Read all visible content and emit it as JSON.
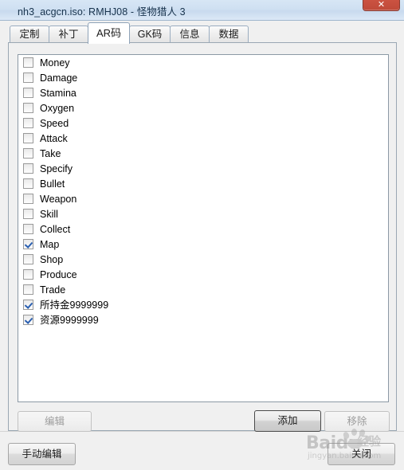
{
  "window": {
    "title": "nh3_acgcn.iso: RMHJ08 - 怪物猎人 3",
    "close_glyph": "✕"
  },
  "tabs": [
    {
      "label": "定制",
      "active": false
    },
    {
      "label": "补丁",
      "active": false
    },
    {
      "label": "AR码",
      "active": true
    },
    {
      "label": "GK码",
      "active": false
    },
    {
      "label": "信息",
      "active": false
    },
    {
      "label": "数据",
      "active": false
    }
  ],
  "cheat_list": [
    {
      "label": "Money",
      "checked": false
    },
    {
      "label": "Damage",
      "checked": false
    },
    {
      "label": "Stamina",
      "checked": false
    },
    {
      "label": "Oxygen",
      "checked": false
    },
    {
      "label": "Speed",
      "checked": false
    },
    {
      "label": "Attack",
      "checked": false
    },
    {
      "label": "Take",
      "checked": false
    },
    {
      "label": "Specify",
      "checked": false
    },
    {
      "label": "Bullet",
      "checked": false
    },
    {
      "label": "Weapon",
      "checked": false
    },
    {
      "label": "Skill",
      "checked": false
    },
    {
      "label": "Collect",
      "checked": false
    },
    {
      "label": "Map",
      "checked": true
    },
    {
      "label": "Shop",
      "checked": false
    },
    {
      "label": "Produce",
      "checked": false
    },
    {
      "label": "Trade",
      "checked": false
    },
    {
      "label": "所持金9999999",
      "checked": true
    },
    {
      "label": "资源9999999",
      "checked": true
    }
  ],
  "panel_buttons": {
    "edit": {
      "label": "编辑",
      "enabled": false
    },
    "add": {
      "label": "添加",
      "enabled": true
    },
    "remove": {
      "label": "移除",
      "enabled": false
    }
  },
  "bottom_buttons": {
    "manual_edit": {
      "label": "手动编辑",
      "enabled": true
    },
    "close": {
      "label": "关闭",
      "enabled": true
    }
  },
  "watermark": {
    "main": "Baidu",
    "cn": "经验",
    "sub": "jingyan.baidu.com"
  },
  "colors": {
    "titlebar": "#cfe0f2",
    "close_button": "#c8503f",
    "check_mark": "#2a5fb0",
    "window_bg": "#f0f0f0",
    "list_bg": "#ffffff"
  }
}
